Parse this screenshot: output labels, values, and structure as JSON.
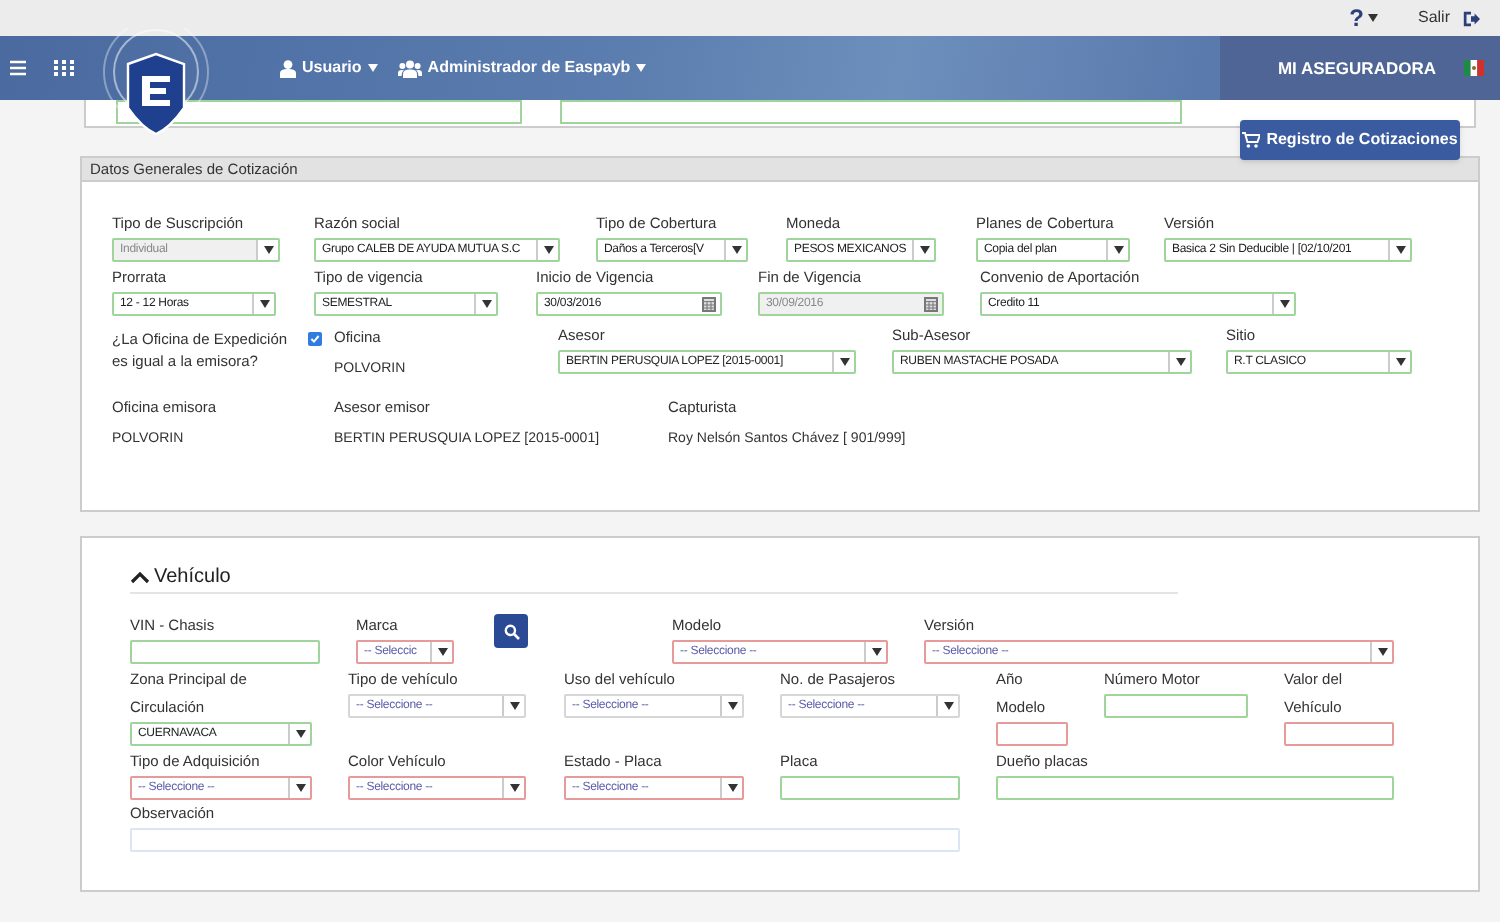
{
  "top_bar": {
    "help": "?",
    "logout": "Salir"
  },
  "header": {
    "user_menu": "Usuario",
    "role_menu": "Administrador de Easpayb",
    "company": "MI ASEGURADORA"
  },
  "previous_fields": [
    {
      "valid": true
    },
    {
      "valid": true
    }
  ],
  "registry_button": "Registro de Cotizaciones",
  "quote_section": {
    "title": "Datos Generales de Cotización",
    "fields": [
      {
        "label": "Tipo de Suscripción",
        "kind": "select",
        "value": "Individual",
        "valid": true,
        "error": false,
        "disabled": true
      },
      {
        "label": "Razón social",
        "kind": "select",
        "value": "Grupo CALEB DE AYUDA MUTUA S.C",
        "valid": true,
        "error": false,
        "disabled": false
      },
      {
        "label": "Tipo de Cobertura",
        "kind": "select",
        "value": "Daños a Terceros[V",
        "valid": true,
        "error": false,
        "disabled": false
      },
      {
        "label": "Moneda",
        "kind": "select",
        "value": "PESOS MEXICANOS",
        "valid": true,
        "error": false,
        "disabled": false
      },
      {
        "label": "Planes de Cobertura",
        "kind": "select",
        "value": "Copia del plan",
        "valid": true,
        "error": false,
        "disabled": false
      },
      {
        "label": "Versión",
        "kind": "select",
        "value": "Basica 2 Sin Deducible | [02/10/201",
        "valid": true,
        "error": false,
        "disabled": false
      },
      {
        "label": "Prorrata",
        "kind": "select",
        "value": "12 - 12 Horas",
        "valid": true,
        "error": false,
        "disabled": false
      },
      {
        "label": "Tipo de vigencia",
        "kind": "select",
        "value": "SEMESTRAL",
        "valid": true,
        "error": false,
        "disabled": false
      },
      {
        "label": "Inicio de Vigencia",
        "kind": "date",
        "value": "30/03/2016",
        "valid": true,
        "error": false,
        "disabled": false
      },
      {
        "label": "Fin de Vigencia",
        "kind": "date",
        "value": "30/09/2016",
        "valid": true,
        "error": false,
        "disabled": true
      },
      {
        "label": "Convenio de Aportación",
        "kind": "select",
        "value": "Credito 11",
        "valid": true,
        "error": false,
        "disabled": false
      },
      {
        "label": "¿La Oficina de Expedición es igual a la emisora?",
        "kind": "checkbox",
        "checked": true
      },
      {
        "label": "Oficina",
        "kind": "static",
        "value": "POLVORIN"
      },
      {
        "label": "Asesor",
        "kind": "select",
        "value": "BERTIN PERUSQUIA LOPEZ [2015-0001]",
        "valid": true,
        "error": false,
        "disabled": false
      },
      {
        "label": "Sub-Asesor",
        "kind": "select",
        "value": "RUBEN MASTACHE POSADA",
        "valid": true,
        "error": false,
        "disabled": false
      },
      {
        "label": "Sitio",
        "kind": "select",
        "value": "R.T CLASICO",
        "valid": true,
        "error": false,
        "disabled": false
      },
      {
        "label": "Oficina emisora",
        "kind": "static",
        "value": "POLVORIN"
      },
      {
        "label": "Asesor emisor",
        "kind": "static",
        "value": "BERTIN PERUSQUIA LOPEZ [2015-0001]"
      },
      {
        "label": "Capturista",
        "kind": "static",
        "value": "Roy Nelsón Santos Chávez [ 901/999]"
      }
    ]
  },
  "vehicle_section": {
    "title": "Vehículo",
    "expanded": true,
    "fields": [
      {
        "label": "VIN - Chasis",
        "kind": "text",
        "valid": true,
        "error": false
      },
      {
        "label": "Marca",
        "kind": "select",
        "placeholder": "-- Seleccic",
        "valid": false,
        "error": true
      },
      {
        "kind": "search_button"
      },
      {
        "label": "Modelo",
        "kind": "select",
        "placeholder": "-- Seleccione --",
        "valid": false,
        "error": true
      },
      {
        "label": "Versión",
        "kind": "select",
        "placeholder": "-- Seleccione --",
        "valid": false,
        "error": true
      },
      {
        "label": "Zona Principal de Circulación",
        "kind": "select",
        "value": "CUERNAVACA",
        "valid": true,
        "error": false
      },
      {
        "label": "Tipo de vehículo",
        "kind": "select",
        "placeholder": "-- Seleccione --",
        "valid": false,
        "error": false
      },
      {
        "label": "Uso del vehículo",
        "kind": "select",
        "placeholder": "-- Seleccione --",
        "valid": false,
        "error": false
      },
      {
        "label": "No. de Pasajeros",
        "kind": "select",
        "placeholder": "-- Seleccione --",
        "valid": false,
        "error": false
      },
      {
        "label": "Año Modelo",
        "kind": "text",
        "valid": false,
        "error": true
      },
      {
        "label": "Número Motor",
        "kind": "text",
        "valid": true,
        "error": false
      },
      {
        "label": "Valor del Vehículo",
        "kind": "text",
        "valid": false,
        "error": true
      },
      {
        "label": "Tipo de Adquisición",
        "kind": "select",
        "placeholder": "-- Seleccione --",
        "valid": false,
        "error": true
      },
      {
        "label": "Color Vehículo",
        "kind": "select",
        "placeholder": "-- Seleccione --",
        "valid": false,
        "error": true
      },
      {
        "label": "Estado - Placa",
        "kind": "select",
        "placeholder": "-- Seleccione --",
        "valid": false,
        "error": true
      },
      {
        "label": "Placa",
        "kind": "text",
        "valid": true,
        "error": false
      },
      {
        "label": "Dueño placas",
        "kind": "text",
        "valid": true,
        "error": false
      },
      {
        "label": "Observación",
        "kind": "text",
        "valid": false,
        "error": false
      }
    ]
  }
}
